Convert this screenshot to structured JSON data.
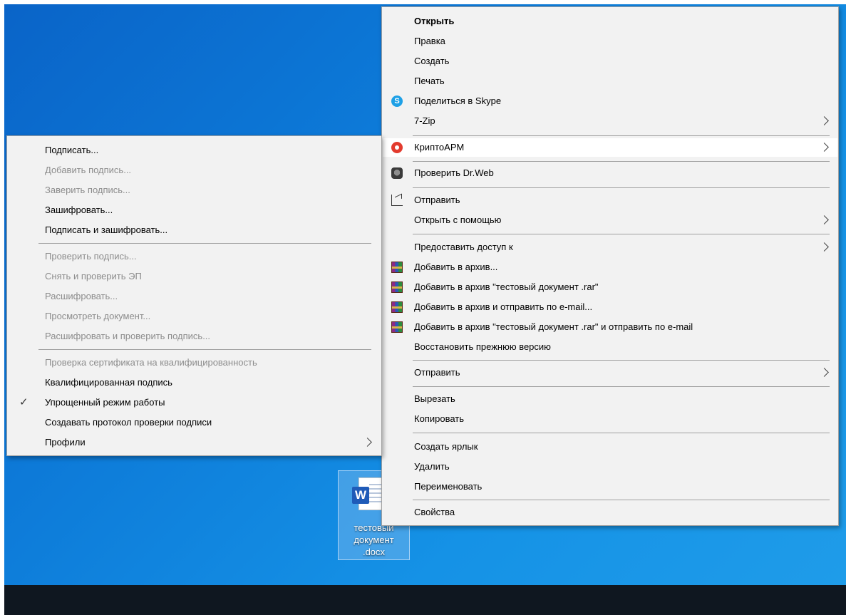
{
  "desktop": {
    "file": {
      "icon": "word-document-icon",
      "name": "тестовый\nдокумент\n.docx"
    }
  },
  "context_menu": {
    "open": "Открыть",
    "edit": "Правка",
    "create": "Создать",
    "print": "Печать",
    "share_skype": "Поделиться в Skype",
    "seven_zip": "7-Zip",
    "cryptoarm": "КриптоАРМ",
    "drweb": "Проверить Dr.Web",
    "send_share": "Отправить",
    "open_with": "Открыть с помощью",
    "give_access": "Предоставить доступ к",
    "add_archive": "Добавить в архив...",
    "add_archive_named": "Добавить в архив \"тестовый документ .rar\"",
    "add_archive_email": "Добавить в архив и отправить по e-mail...",
    "add_archive_named_email": "Добавить в архив \"тестовый документ .rar\" и отправить по e-mail",
    "restore_version": "Восстановить прежнюю версию",
    "send_to": "Отправить",
    "cut": "Вырезать",
    "copy": "Копировать",
    "create_shortcut": "Создать ярлык",
    "delete": "Удалить",
    "rename": "Переименовать",
    "properties": "Свойства"
  },
  "cryptoarm_submenu": {
    "sign": "Подписать...",
    "add_signature": "Добавить подпись...",
    "certify_signature": "Заверить подпись...",
    "encrypt": "Зашифровать...",
    "sign_encrypt": "Подписать и зашифровать...",
    "verify_signature": "Проверить подпись...",
    "remove_verify": "Снять и проверить ЭП",
    "decrypt": "Расшифровать...",
    "view_document": "Просмотреть документ...",
    "decrypt_verify": "Расшифровать и проверить подпись...",
    "cert_qualified_check": "Проверка сертификата на квалифицированность",
    "qualified_signature": "Квалифицированная подпись",
    "simplified_mode": "Упрощенный режим работы",
    "simplified_mode_checked": true,
    "create_protocol": "Создавать протокол проверки подписи",
    "profiles": "Профили"
  }
}
